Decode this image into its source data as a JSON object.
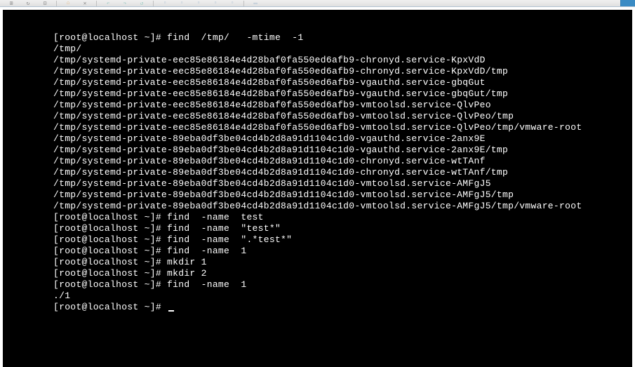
{
  "toolbar": {
    "icons": [
      "grid",
      "refresh",
      "grid2",
      "home",
      "x",
      "arrow-left",
      "arrow-right",
      "arrow-curve",
      "doc1",
      "doc2",
      "doc3",
      "doc4",
      "docs",
      "window"
    ]
  },
  "terminal": {
    "prompt": "[root@localhost ~]# ",
    "lines": [
      {
        "prompt": true,
        "cmd": "find  /tmp/   -mtime  -1"
      },
      {
        "out": "/tmp/"
      },
      {
        "out": "/tmp/systemd-private-eec85e86184e4d28baf0fa550ed6afb9-chronyd.service-KpxVdD"
      },
      {
        "out": "/tmp/systemd-private-eec85e86184e4d28baf0fa550ed6afb9-chronyd.service-KpxVdD/tmp"
      },
      {
        "out": "/tmp/systemd-private-eec85e86184e4d28baf0fa550ed6afb9-vgauthd.service-gbqGut"
      },
      {
        "out": "/tmp/systemd-private-eec85e86184e4d28baf0fa550ed6afb9-vgauthd.service-gbqGut/tmp"
      },
      {
        "out": "/tmp/systemd-private-eec85e86184e4d28baf0fa550ed6afb9-vmtoolsd.service-QlvPeo"
      },
      {
        "out": "/tmp/systemd-private-eec85e86184e4d28baf0fa550ed6afb9-vmtoolsd.service-QlvPeo/tmp"
      },
      {
        "out": "/tmp/systemd-private-eec85e86184e4d28baf0fa550ed6afb9-vmtoolsd.service-QlvPeo/tmp/vmware-root"
      },
      {
        "out": "/tmp/systemd-private-89eba0df3be04cd4b2d8a91d1104c1d0-vgauthd.service-2anx9E"
      },
      {
        "out": "/tmp/systemd-private-89eba0df3be04cd4b2d8a91d1104c1d0-vgauthd.service-2anx9E/tmp"
      },
      {
        "out": "/tmp/systemd-private-89eba0df3be04cd4b2d8a91d1104c1d0-chronyd.service-wtTAnf"
      },
      {
        "out": "/tmp/systemd-private-89eba0df3be04cd4b2d8a91d1104c1d0-chronyd.service-wtTAnf/tmp"
      },
      {
        "out": "/tmp/systemd-private-89eba0df3be04cd4b2d8a91d1104c1d0-vmtoolsd.service-AMFgJ5"
      },
      {
        "out": "/tmp/systemd-private-89eba0df3be04cd4b2d8a91d1104c1d0-vmtoolsd.service-AMFgJ5/tmp"
      },
      {
        "out": "/tmp/systemd-private-89eba0df3be04cd4b2d8a91d1104c1d0-vmtoolsd.service-AMFgJ5/tmp/vmware-root"
      },
      {
        "prompt": true,
        "cmd": "find  -name  test"
      },
      {
        "prompt": true,
        "cmd": "find  -name  \"test*\""
      },
      {
        "prompt": true,
        "cmd": "find  -name  \".*test*\""
      },
      {
        "prompt": true,
        "cmd": "find  -name  1"
      },
      {
        "prompt": true,
        "cmd": "mkdir 1"
      },
      {
        "prompt": true,
        "cmd": "mkdir 2"
      },
      {
        "prompt": true,
        "cmd": "find  -name  1"
      },
      {
        "out": "./1"
      },
      {
        "prompt": true,
        "cmd": "",
        "cursor": true
      }
    ]
  }
}
